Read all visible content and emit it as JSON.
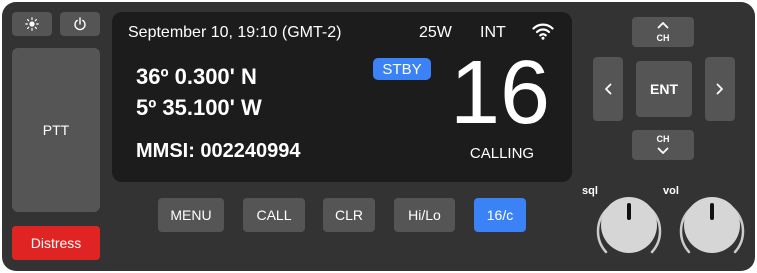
{
  "top_controls": {
    "brightness_icon": "sun-icon",
    "power_icon": "power-icon"
  },
  "ptt_label": "PTT",
  "distress_label": "Distress",
  "screen": {
    "datetime": "September 10, 19:10 (GMT-2)",
    "power": "25W",
    "mode": "INT",
    "wifi_icon": "wifi-icon",
    "latitude": "36º 0.300' N",
    "longitude": "5º 35.100' W",
    "mmsi": "MMSI: 002240994",
    "status_badge": "STBY",
    "channel": "16",
    "channel_status": "CALLING"
  },
  "softkeys": [
    {
      "label": "MENU",
      "active": false
    },
    {
      "label": "CALL",
      "active": false
    },
    {
      "label": "CLR",
      "active": false
    },
    {
      "label": "Hi/Lo",
      "active": false
    },
    {
      "label": "16/c",
      "active": true
    }
  ],
  "nav": {
    "ch_up_label": "CH",
    "ch_down_label": "CH",
    "enter_label": "ENT",
    "left_icon": "chevron-left-icon",
    "right_icon": "chevron-right-icon"
  },
  "knobs": {
    "squelch_label": "sql",
    "volume_label": "vol"
  },
  "colors": {
    "body": "#333333",
    "button": "#555555",
    "screen": "#1c1c1c",
    "accent": "#3b82f6",
    "distress": "#e02424"
  }
}
